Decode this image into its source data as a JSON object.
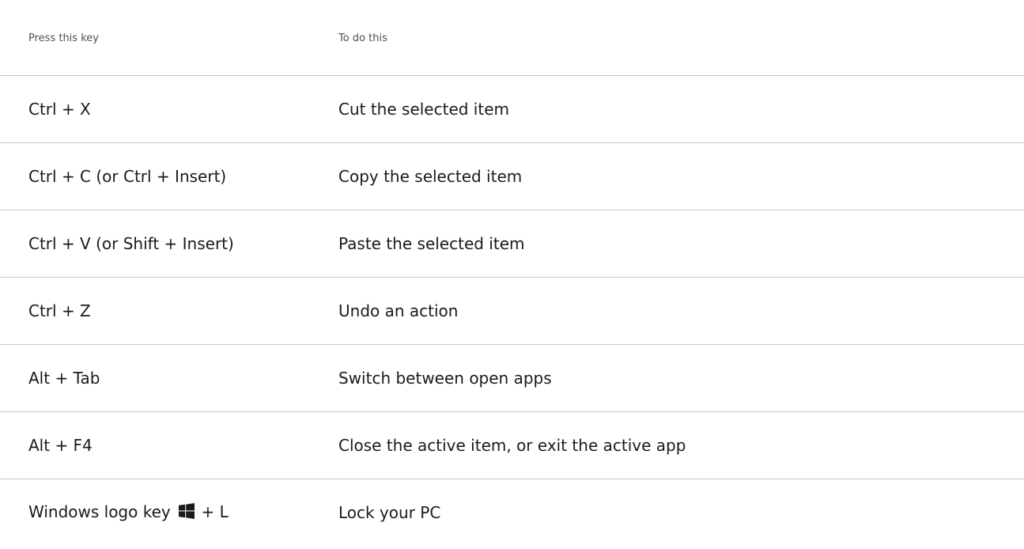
{
  "table": {
    "headers": {
      "key": "Press this key",
      "action": "To do this"
    },
    "rows": [
      {
        "key": "Ctrl + X",
        "action": "Cut the selected item"
      },
      {
        "key": "Ctrl + C (or Ctrl + Insert)",
        "action": "Copy the selected item"
      },
      {
        "key": "Ctrl + V (or Shift + Insert)",
        "action": "Paste the selected item"
      },
      {
        "key": "Ctrl + Z",
        "action": "Undo an action"
      },
      {
        "key": "Alt + Tab",
        "action": "Switch between open apps"
      },
      {
        "key": "Alt + F4",
        "action": "Close the active item, or exit the active app"
      },
      {
        "key_prefix": "Windows logo key",
        "key_suffix": "+ L",
        "action": "Lock your PC",
        "icon": "windows-logo-icon"
      }
    ]
  }
}
